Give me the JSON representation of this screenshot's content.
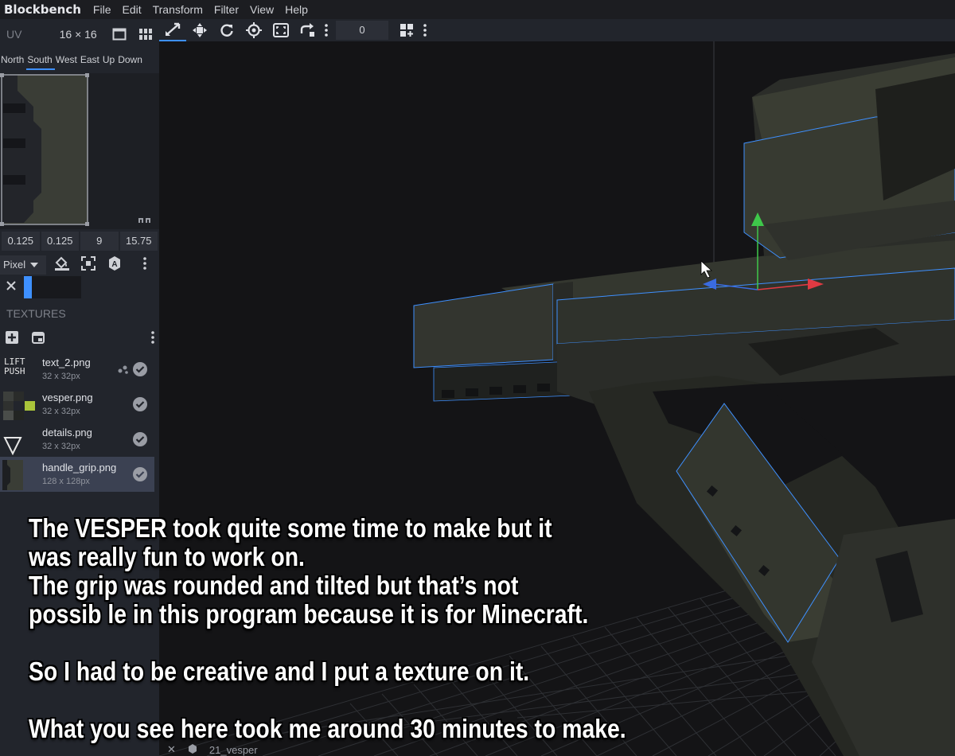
{
  "app": {
    "name": "Blockbench",
    "menu": [
      "File",
      "Edit",
      "Transform",
      "Filter",
      "View",
      "Help"
    ]
  },
  "uv_panel": {
    "title": "UV",
    "size": "16 × 16",
    "faces": [
      "North",
      "South",
      "West",
      "East",
      "Up",
      "Down"
    ],
    "active_face": "South",
    "values": [
      "0.125",
      "0.125",
      "9",
      "15.75"
    ],
    "paint_mode": "Pixel"
  },
  "textures": {
    "label": "TEXTURES",
    "items": [
      {
        "name": "text_2.png",
        "dims": "32 x 32px",
        "selected": false
      },
      {
        "name": "vesper.png",
        "dims": "32 x 32px",
        "selected": false
      },
      {
        "name": "details.png",
        "dims": "32 x 32px",
        "selected": false
      },
      {
        "name": "handle_grip.png",
        "dims": "128 x 128px",
        "selected": true
      }
    ]
  },
  "viewport_toolbar": {
    "number_value": "0"
  },
  "status": {
    "close": "✕",
    "model": "21_vesper"
  },
  "caption": {
    "line1": "The VESPER took quite some time to make but it",
    "line2": "was really fun to work on.",
    "line3": "The grip was rounded and tilted but that’s not",
    "line4": "possib le in this program because it is for Minecraft.",
    "line5": "So I had to be creative and I put a texture on it.",
    "line6": "What you see here took me around 30 minutes to make."
  },
  "colors": {
    "accent": "#3e90ff",
    "panel": "#22252c",
    "viewport": "#141416",
    "model": "#3a3d3a",
    "selection_outline": "#3e90ff"
  }
}
